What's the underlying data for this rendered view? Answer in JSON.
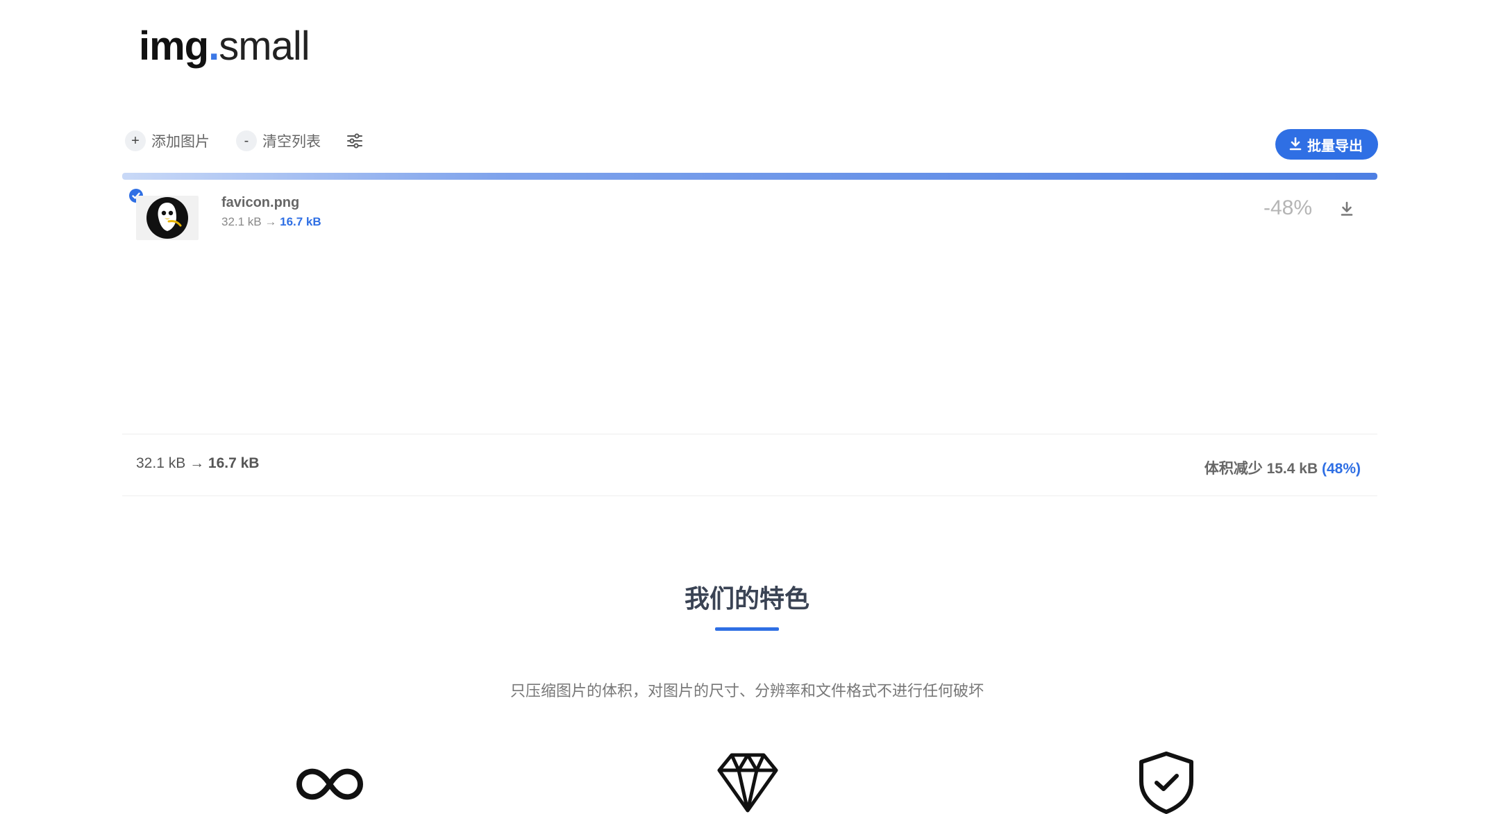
{
  "header": {
    "logo_bold": "img",
    "logo_dot": ".",
    "logo_light": "small"
  },
  "toolbar": {
    "add_icon": "+",
    "add_label": "添加图片",
    "clear_icon": "-",
    "clear_label": "清空列表",
    "settings_icon": "sliders-icon",
    "export_label": "批量导出"
  },
  "progress": {
    "percent": 100
  },
  "files": [
    {
      "name": "favicon.png",
      "original_size": "32.1 kB",
      "arrow": "→",
      "compressed_size": "16.7 kB",
      "ratio": "-48%",
      "selected": true
    }
  ],
  "summary": {
    "original": "32.1 kB",
    "arrow": "→",
    "compressed": "16.7 kB",
    "reduced_label": "体积减少",
    "reduced_amount": "15.4 kB",
    "reduced_percent": "(48%)"
  },
  "features": {
    "title": "我们的特色",
    "description": "只压缩图片的体积，对图片的尺寸、分辨率和文件格式不进行任何破坏",
    "icons": [
      "infinity-icon",
      "diamond-icon",
      "shield-check-icon"
    ]
  },
  "colors": {
    "accent": "#2f6fe4"
  }
}
